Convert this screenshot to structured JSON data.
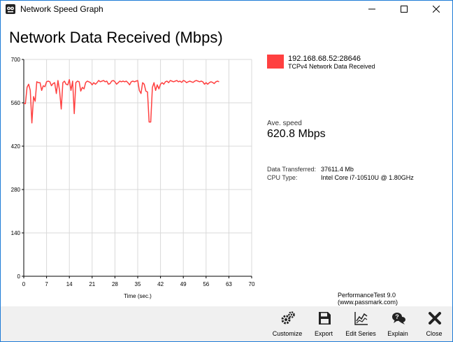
{
  "window": {
    "title": "Network Speed Graph",
    "accent": "#1e7bd6"
  },
  "heading": "Network Data Received (Mbps)",
  "legend": {
    "name": "192.168.68.52:28646",
    "sub": "TCPv4 Network Data Received",
    "color": "#ff4040"
  },
  "stats": {
    "ave_label": "Ave. speed",
    "ave_value": "620.8 Mbps",
    "rows": [
      {
        "label": "Data Transferred:",
        "value": "37611.4 Mb"
      },
      {
        "label": "CPU Type:",
        "value": "Intel Core i7-10510U @ 1.80GHz"
      }
    ]
  },
  "credit": "PerformanceTest 9.0 (www.passmark.com)",
  "footer_buttons": [
    {
      "label": "Customize",
      "icon": "gears-icon"
    },
    {
      "label": "Export",
      "icon": "floppy-disk-icon"
    },
    {
      "label": "Edit Series",
      "icon": "line-chart-icon"
    },
    {
      "label": "Explain",
      "icon": "help-bubble-icon"
    },
    {
      "label": "Close",
      "icon": "close-x-icon"
    }
  ],
  "chart_data": {
    "type": "line",
    "title": "Network Data Received (Mbps)",
    "xlabel": "Time (sec.)",
    "ylabel": "",
    "xlim": [
      0,
      70
    ],
    "ylim": [
      0,
      700
    ],
    "xticks": [
      "0",
      "7",
      "14",
      "21",
      "28",
      "35",
      "42",
      "49",
      "56",
      "63",
      "70"
    ],
    "yticks": [
      "0",
      "140",
      "280",
      "420",
      "560",
      "700"
    ],
    "grid": true,
    "series": [
      {
        "name": "192.168.68.52:28646",
        "color": "#ff4040",
        "x": [
          0,
          0.5,
          1,
          1.5,
          2,
          2.5,
          3,
          3.5,
          4,
          4.5,
          5,
          5.5,
          6,
          6.5,
          7,
          7.5,
          8,
          8.5,
          9,
          9.5,
          10,
          10.5,
          11,
          11.5,
          12,
          12.5,
          13,
          13.5,
          14,
          14.5,
          15,
          15.5,
          16,
          16.5,
          17,
          17.5,
          18,
          18.5,
          19,
          19.5,
          20,
          20.5,
          21,
          21.5,
          22,
          22.5,
          23,
          23.5,
          24,
          24.5,
          25,
          25.5,
          26,
          26.5,
          27,
          27.5,
          28,
          28.5,
          29,
          29.5,
          30,
          30.5,
          31,
          31.5,
          32,
          32.5,
          33,
          33.5,
          34,
          34.5,
          35,
          35.5,
          36,
          36.5,
          37,
          37.5,
          38,
          38.5,
          39,
          39.5,
          40,
          40.5,
          41,
          41.5,
          42,
          42.5,
          43,
          43.5,
          44,
          44.5,
          45,
          45.5,
          46,
          46.5,
          47,
          47.5,
          48,
          48.5,
          49,
          49.5,
          50,
          50.5,
          51,
          51.5,
          52,
          52.5,
          53,
          53.5,
          54,
          54.5,
          55,
          55.5,
          56,
          56.5,
          57,
          57.5,
          58,
          58.5,
          59,
          59.5,
          60
        ],
        "y": [
          558,
          557,
          610,
          620,
          600,
          495,
          580,
          565,
          628,
          625,
          625,
          600,
          615,
          612,
          628,
          630,
          628,
          615,
          622,
          625,
          590,
          632,
          600,
          540,
          625,
          630,
          620,
          618,
          635,
          600,
          630,
          525,
          625,
          630,
          628,
          598,
          610,
          605,
          625,
          630,
          628,
          625,
          618,
          625,
          620,
          625,
          632,
          628,
          630,
          632,
          628,
          630,
          620,
          622,
          630,
          632,
          628,
          620,
          625,
          630,
          628,
          630,
          628,
          630,
          625,
          618,
          628,
          630,
          628,
          630,
          632,
          600,
          590,
          625,
          620,
          598,
          595,
          498,
          498,
          610,
          625,
          600,
          618,
          605,
          620,
          625,
          620,
          628,
          630,
          625,
          632,
          630,
          628,
          630,
          632,
          628,
          630,
          626,
          632,
          630,
          625,
          628,
          630,
          628,
          626,
          630,
          632,
          630,
          628,
          630,
          628,
          620,
          625,
          620,
          625,
          628,
          626,
          622,
          628,
          630,
          628
        ]
      }
    ]
  }
}
